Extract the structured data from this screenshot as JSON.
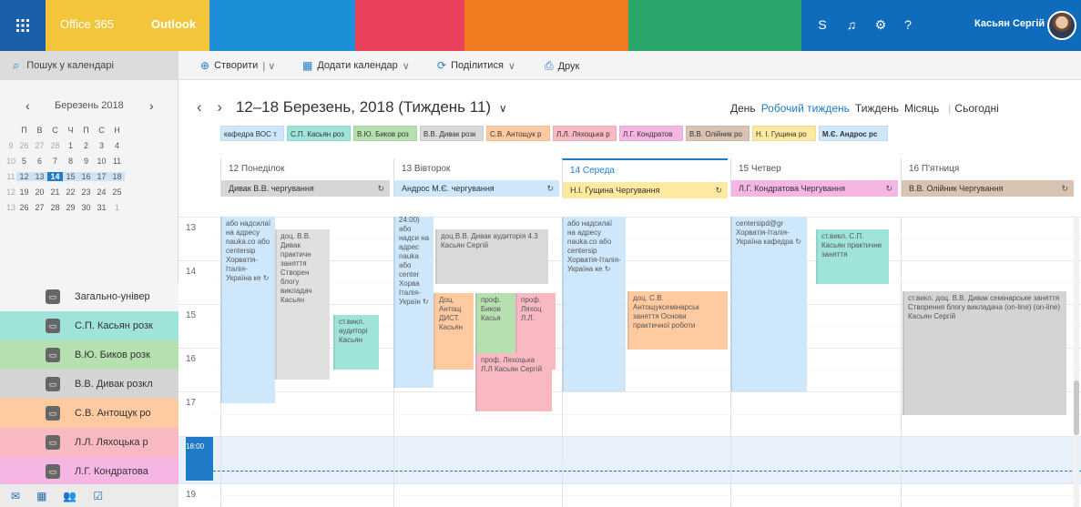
{
  "topbar": {
    "app_name": "Office 365",
    "product": "Outlook",
    "user_name": "Касьян Сергій",
    "icons": [
      "skype-icon",
      "bell-icon",
      "gear-icon",
      "help-icon"
    ],
    "help_label": "?",
    "accent": "#1f7ac8"
  },
  "cmdbar": {
    "search_placeholder": "Пошук у календарі",
    "create": "Створити",
    "add_calendar": "Додати календар",
    "share": "Поділитися",
    "print": "Друк"
  },
  "minical": {
    "month": "Березень 2018",
    "weekdays": [
      "П",
      "В",
      "С",
      "Ч",
      "П",
      "С",
      "Н"
    ],
    "weeks": [
      {
        "wk": "9",
        "days": [
          "26",
          "27",
          "28",
          "1",
          "2",
          "3",
          "4"
        ]
      },
      {
        "wk": "10",
        "days": [
          "5",
          "6",
          "7",
          "8",
          "9",
          "10",
          "11"
        ]
      },
      {
        "wk": "11",
        "days": [
          "12",
          "13",
          "14",
          "15",
          "16",
          "17",
          "18"
        ]
      },
      {
        "wk": "12",
        "days": [
          "19",
          "20",
          "21",
          "22",
          "23",
          "24",
          "25"
        ]
      },
      {
        "wk": "13",
        "days": [
          "26",
          "27",
          "28",
          "29",
          "30",
          "31",
          "1"
        ]
      }
    ]
  },
  "calendars": [
    {
      "label": "Загально-універ",
      "color": "#f4f4f4"
    },
    {
      "label": "С.П. Касьян розк",
      "color": "#9fe3da"
    },
    {
      "label": "В.Ю. Биков розк",
      "color": "#b6e0b0"
    },
    {
      "label": "В.В. Дивак розкл",
      "color": "#d4d4d4"
    },
    {
      "label": "С.В. Антощук ро",
      "color": "#ffcaa0"
    },
    {
      "label": "Л.Л. Ляхоцька р",
      "color": "#f9b9c3"
    },
    {
      "label": "Л.Г. Кондратова",
      "color": "#f6b6e3"
    }
  ],
  "bottom_nav": [
    "mail-icon",
    "calendar-icon",
    "people-icon",
    "tasks-icon"
  ],
  "week": {
    "title": "12–18 Березень, 2018 (Тиждень 11)",
    "views": [
      "День",
      "Робочий тиждень",
      "Тиждень",
      "Місяць",
      "Сьогодні"
    ],
    "active_view": "Робочий тиждень"
  },
  "filters": [
    {
      "label": "кафедра ВОС т",
      "color": "#cfe7fa"
    },
    {
      "label": "С.П. Касьян роз",
      "color": "#9fe3da"
    },
    {
      "label": "В.Ю. Биков роз",
      "color": "#b6e0b0"
    },
    {
      "label": "В.В. Дивак розк",
      "color": "#d9d9d9"
    },
    {
      "label": "С.В. Антощук р",
      "color": "#ffcaa0"
    },
    {
      "label": "Л.Л. Ляхоцька р",
      "color": "#f9b9c3"
    },
    {
      "label": "Л.Г. Кондратов",
      "color": "#f6b6e3"
    },
    {
      "label": "В.В. Олійник ро",
      "color": "#d9c3b2"
    },
    {
      "label": "Н. І. Гущина ро",
      "color": "#fdeaa0"
    },
    {
      "label": "М.Є. Андрос рс",
      "color": "#cfe7fa"
    }
  ],
  "days": [
    {
      "name": "12 Понеділок",
      "allday": "Дивак В.В. чергування",
      "color": "#d6d6d6",
      "icon": "calendar-repeat-icon"
    },
    {
      "name": "13 Вівторок",
      "allday": "Андрос М.Є. чергування",
      "color": "#cfe7fa",
      "icon": "calendar-repeat-icon"
    },
    {
      "name": "14 Середа",
      "allday": "Н.І. Гущина Чергування",
      "color": "#fdeaa0",
      "icon": "repeat-icon"
    },
    {
      "name": "15 Четвер",
      "allday": "Л.Г. Кондратова Чергування",
      "color": "#f6b6e3",
      "icon": "repeat-icon"
    },
    {
      "name": "16 П'ятниця",
      "allday": "В.В. Олійник Чергування",
      "color": "#d9c3b2",
      "icon": "repeat-icon"
    }
  ],
  "hours": [
    "13",
    "14",
    "15",
    "16",
    "17",
    "18:00",
    "19"
  ],
  "events": [
    {
      "day": 0,
      "color": "#cfe7fa",
      "text": "або надсилаї на адресу nauka.co або centersip Хорватія-Італія-Україна ке ↻"
    },
    {
      "day": 0,
      "color": "#e0e0e0",
      "text": "доц. В.В. Дивак практичн заняття Створен блогу викладач Касьян"
    },
    {
      "day": 0,
      "color": "#9fe3da",
      "text": "ст.викл. аудиторі Касьян"
    },
    {
      "day": 1,
      "color": "#cfe7fa",
      "text": "24:00) або надси на адрес nauka або center Хорва Італія-Україн ↻"
    },
    {
      "day": 1,
      "color": "#d9d9d9",
      "text": "доц.В.В. Дивак аудиторія 4.3 Касьян Сергій"
    },
    {
      "day": 1,
      "color": "#ffcaa0",
      "text": "Доц. Антощ ДИСТ. Касьян"
    },
    {
      "day": 1,
      "color": "#b6e0b0",
      "text": "проф. Биков Касья"
    },
    {
      "day": 1,
      "color": "#f9b9c3",
      "text": "проф. Ляхоц Л.Л."
    },
    {
      "day": 1,
      "color": "#f9b9c3",
      "text": "проф. Ляхоцька Л.Л Касьян Сергій"
    },
    {
      "day": 2,
      "color": "#cfe7fa",
      "text": "або надсилаї на адресу nauka.co або centersip Хорватія-Італія-Україна ке ↻"
    },
    {
      "day": 2,
      "color": "#ffcaa0",
      "text": "доц. С.В. Антощуксемінарськ заняття Основи практичної роботи"
    },
    {
      "day": 3,
      "color": "#cfe7fa",
      "text": "centersipd@gr Хорватія-Італія-Україна кафедра ↻"
    },
    {
      "day": 3,
      "color": "#9fe3da",
      "text": "ст.викл. С.П. Касьян практичне заняття"
    },
    {
      "day": 4,
      "color": "#d4d4d4",
      "text": "ст.викл. доц. В.В. Дивак семінарське заняття Створення блогу викладача (on-line) (on-line) Касьян Сергій"
    }
  ]
}
